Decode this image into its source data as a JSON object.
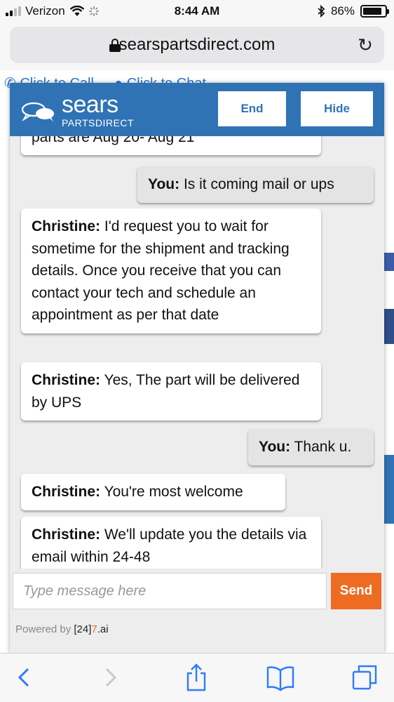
{
  "status_bar": {
    "carrier": "Verizon",
    "time": "8:44 AM",
    "battery_percent": "86%",
    "battery_level": 0.86
  },
  "browser": {
    "url": "searspartsdirect.com"
  },
  "background_page": {
    "call_link": "Click to Call",
    "chat_link": "Click to Chat"
  },
  "chat": {
    "brand_name": "sears",
    "brand_sub": "PARTSDIRECT",
    "end_label": "End",
    "hide_label": "Hide",
    "messages": [
      {
        "sender": "",
        "text": "parts are Aug 20- Aug 21"
      },
      {
        "sender": "You:",
        "text": "Is it coming mail or ups"
      },
      {
        "sender": "Christine:",
        "text": "I'd request you to wait for sometime for the shipment and tracking details. Once you receive that you can contact your tech and schedule an appointment as per that date"
      },
      {
        "sender": "Christine:",
        "text": "Yes, The part will be delivered by UPS"
      },
      {
        "sender": "You:",
        "text": "Thank u."
      },
      {
        "sender": "Christine:",
        "text": "You're most welcome"
      },
      {
        "sender": "Christine:",
        "text": "We'll update you the details via email within 24-48"
      }
    ],
    "input_placeholder": "Type message here",
    "send_label": "Send",
    "powered_by": "Powered by",
    "powered_brand_a": "[24]",
    "powered_brand_b": "7",
    "powered_brand_c": ".ai"
  },
  "colors": {
    "header_blue": "#2f73b5",
    "send_orange": "#ee6b22"
  },
  "toolbar_icons": [
    "back-icon",
    "forward-icon",
    "share-icon",
    "bookmarks-icon",
    "tabs-icon"
  ]
}
